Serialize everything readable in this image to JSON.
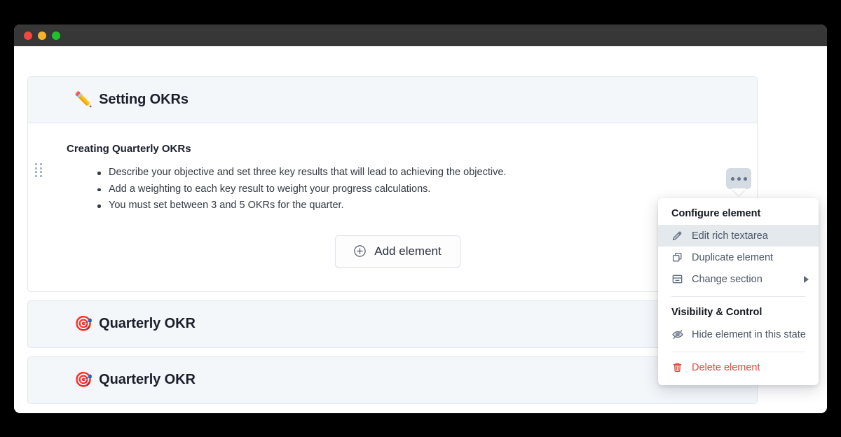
{
  "window": {
    "traffic_lights": [
      {
        "name": "close",
        "color": "#f1473f"
      },
      {
        "name": "minimize",
        "color": "#f5b32b"
      },
      {
        "name": "maximize",
        "color": "#21c02d"
      }
    ]
  },
  "cards": [
    {
      "emoji": "✏️",
      "emoji_name": "pencil-emoji",
      "title": "Setting OKRs",
      "collapsed": false,
      "body": {
        "section_title": "Creating Quarterly OKRs",
        "bullets": [
          "Describe your objective and set three key results that will lead to achieving the objective.",
          "Add a weighting to each key result to weight your progress calculations.",
          "You must set between 3 and 5 OKRs for the quarter."
        ],
        "add_button_label": "Add element"
      }
    },
    {
      "emoji": "🎯",
      "emoji_name": "direct-hit-emoji",
      "title": "Quarterly OKR",
      "collapsed": true
    },
    {
      "emoji": "🎯",
      "emoji_name": "direct-hit-emoji",
      "title": "Quarterly OKR",
      "collapsed": true
    }
  ],
  "menu": {
    "group_one_heading": "Configure element",
    "items_one": [
      {
        "label": "Edit rich textarea",
        "icon": "pencil-icon",
        "active": true,
        "submenu": false
      },
      {
        "label": "Duplicate element",
        "icon": "duplicate-icon",
        "active": false,
        "submenu": false
      },
      {
        "label": "Change section",
        "icon": "section-icon",
        "active": false,
        "submenu": true
      }
    ],
    "group_two_heading": "Visibility & Control",
    "items_two": [
      {
        "label": "Hide element in this state",
        "icon": "eye-off-icon",
        "active": false,
        "submenu": false
      }
    ],
    "delete": {
      "label": "Delete element",
      "icon": "trash-icon",
      "color": "#e1493f"
    }
  },
  "colors": {
    "card_header_bg": "#f4f7fa",
    "card_border": "#e1e6eb",
    "titlebar": "#373737",
    "menu_active_bg": "#e4e9ee",
    "danger": "#e1493f",
    "text_primary": "#1b1f2b",
    "text_secondary": "#4c5563"
  }
}
